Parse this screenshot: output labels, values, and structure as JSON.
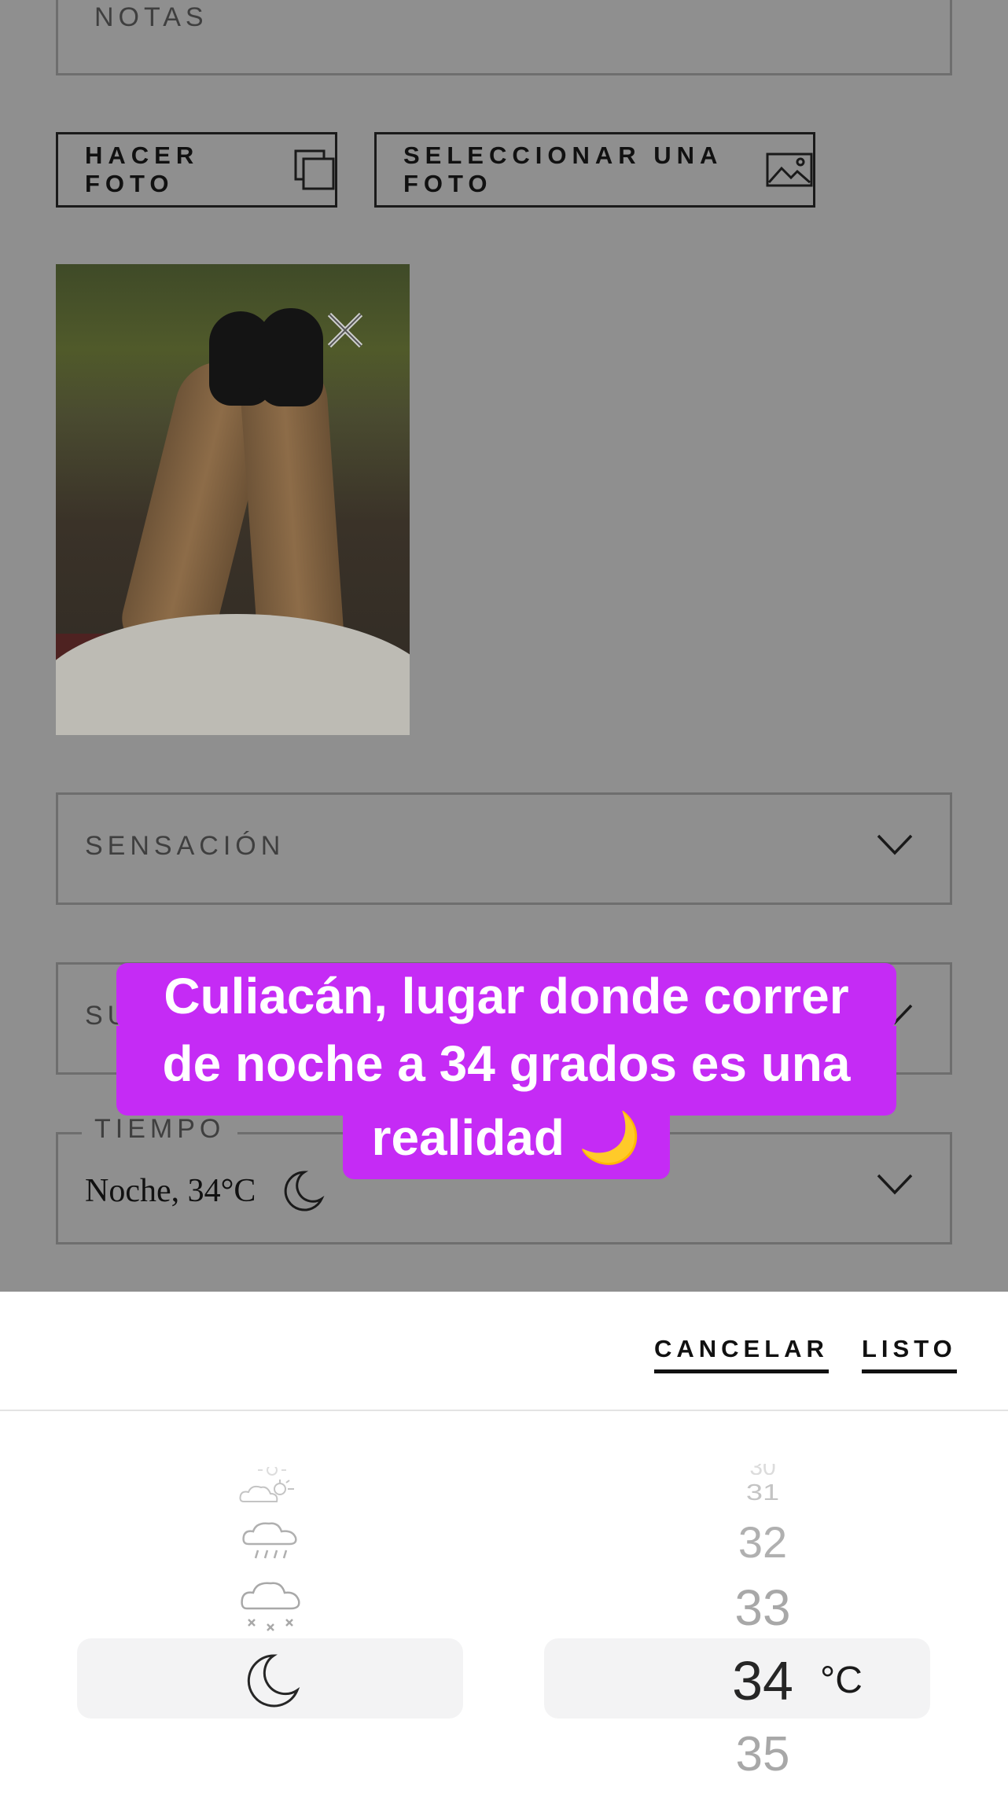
{
  "form": {
    "notes_label": "NOTAS",
    "take_photo_label": "HACER FOTO",
    "select_photo_label": "SELECCIONAR UNA FOTO",
    "sensation_label": "SENSACIÓN",
    "surface_label": "SU",
    "weather_label": "TIEMPO",
    "weather_value": "Noche, 34°C"
  },
  "caption": {
    "line1": "Culiacán, lugar donde correr",
    "line2": "de noche a 34 grados es una",
    "line3": "realidad 🌙"
  },
  "picker": {
    "cancel_label": "CANCELAR",
    "done_label": "LISTO",
    "weather_options": [
      "partly-cloudy-sun-icon",
      "rain-icon",
      "snow-icon",
      "moon-icon"
    ],
    "selected_weather": "moon-icon",
    "temperatures": [
      "30",
      "31",
      "32",
      "33",
      "34",
      "35"
    ],
    "selected_temperature": "34",
    "unit": "°C"
  }
}
